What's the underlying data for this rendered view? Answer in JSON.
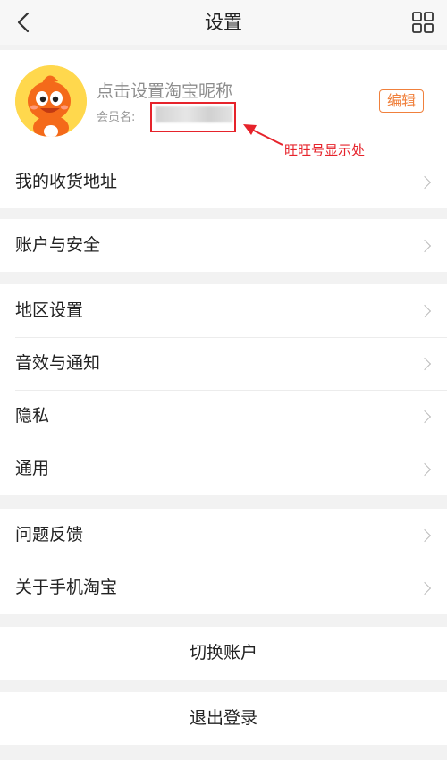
{
  "header": {
    "title": "设置",
    "back_icon": "chevron-left-icon",
    "grid_icon": "grid-icon"
  },
  "profile": {
    "nickname": "点击设置淘宝昵称",
    "member_label": "会员名:",
    "edit_label": "编辑",
    "annotation": "旺旺号显示处",
    "accent_color": "#f0803c",
    "highlight_color": "#e6232b"
  },
  "groups": [
    {
      "items": [
        {
          "label": "我的收货地址"
        }
      ]
    },
    {
      "items": [
        {
          "label": "账户与安全"
        }
      ]
    },
    {
      "items": [
        {
          "label": "地区设置"
        },
        {
          "label": "音效与通知"
        },
        {
          "label": "隐私"
        },
        {
          "label": "通用"
        }
      ]
    },
    {
      "items": [
        {
          "label": "问题反馈"
        },
        {
          "label": "关于手机淘宝"
        }
      ]
    }
  ],
  "actions": {
    "switch_account": "切换账户",
    "logout": "退出登录"
  }
}
